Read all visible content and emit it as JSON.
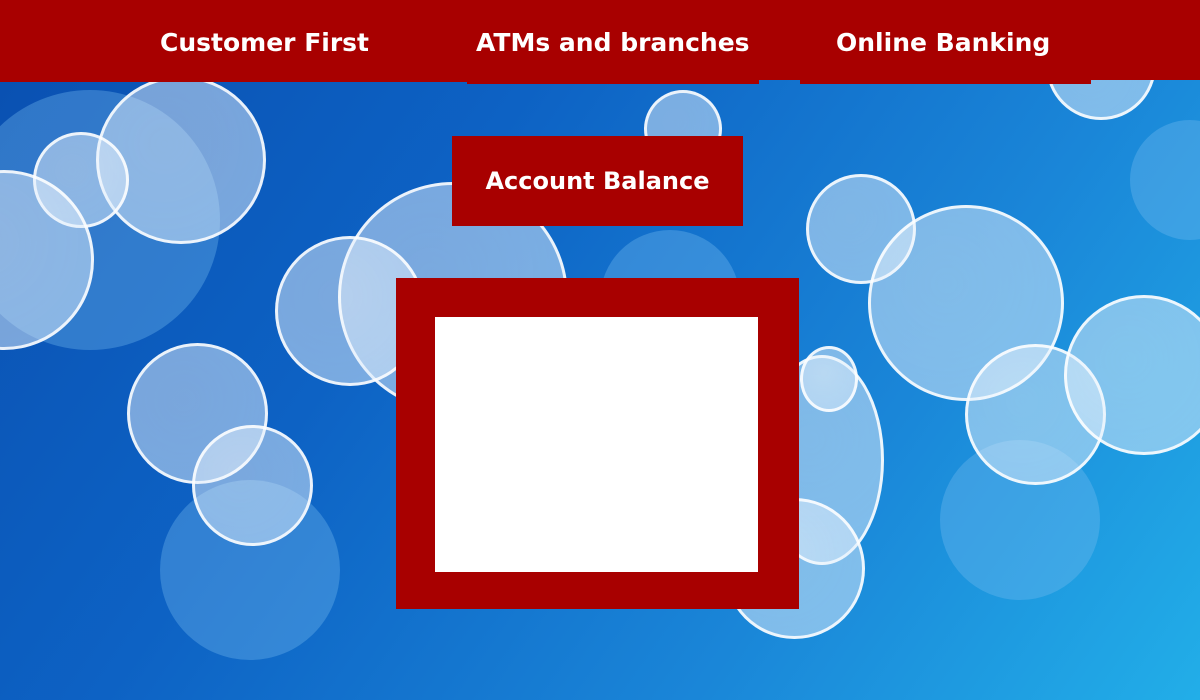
{
  "nav": {
    "items": [
      {
        "label": "Customer First"
      },
      {
        "label": "ATMs and branches"
      },
      {
        "label": "Online Banking"
      }
    ]
  },
  "main": {
    "account_balance_label": "Account Balance",
    "balance_display_value": ""
  },
  "colors": {
    "brand_red": "#a80000",
    "panel_white": "#ffffff",
    "background_blue": "#0d62c4"
  }
}
